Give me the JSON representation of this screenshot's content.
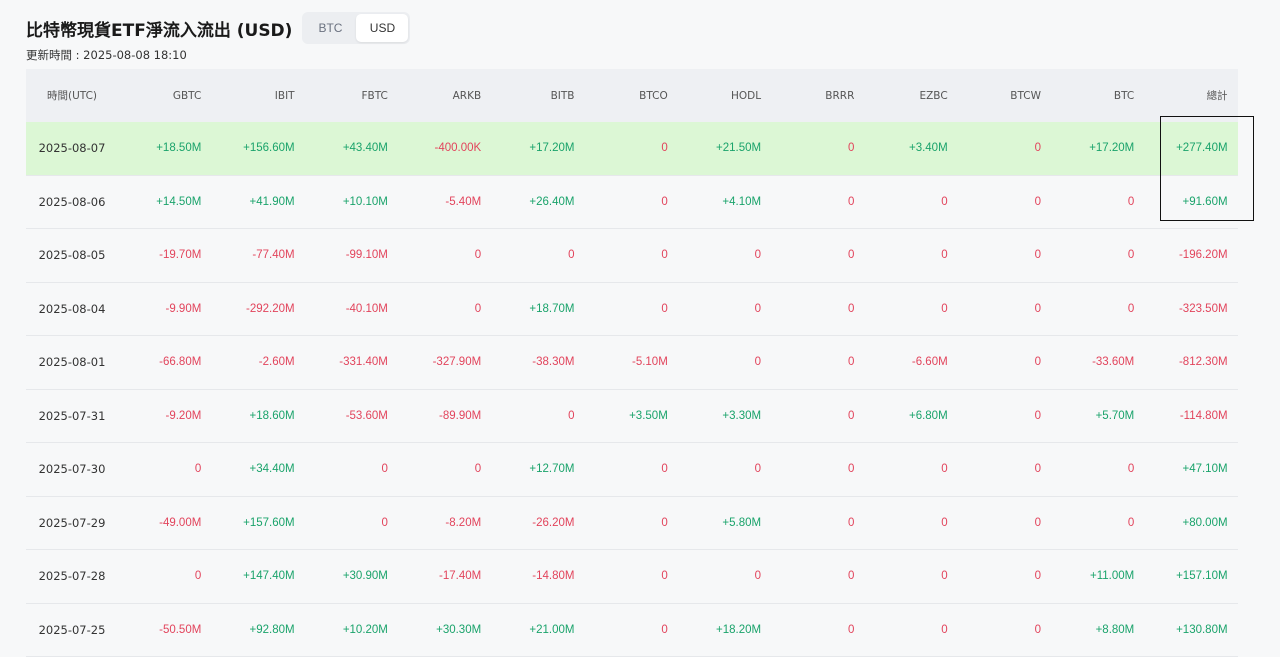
{
  "header": {
    "title": "比特幣現貨ETF淨流入流出 (USD)",
    "toggle": [
      {
        "label": "BTC",
        "active": false
      },
      {
        "label": "USD",
        "active": true
      }
    ]
  },
  "updated": "更新時間 : 2025-08-08 18:10",
  "colors": {
    "positive": "#1aa36b",
    "negative": "#e2445c",
    "highlight_row": "#dcf7d5"
  },
  "table": {
    "columns": [
      "時間(UTC)",
      "GBTC",
      "IBIT",
      "FBTC",
      "ARKB",
      "BITB",
      "BTCO",
      "HODL",
      "BRRR",
      "EZBC",
      "BTCW",
      "BTC",
      "總計"
    ],
    "rows": [
      [
        "2025-08-07",
        "+18.50M",
        "+156.60M",
        "+43.40M",
        "-400.00K",
        "+17.20M",
        "0",
        "+21.50M",
        "0",
        "+3.40M",
        "0",
        "+17.20M",
        "+277.40M"
      ],
      [
        "2025-08-06",
        "+14.50M",
        "+41.90M",
        "+10.10M",
        "-5.40M",
        "+26.40M",
        "0",
        "+4.10M",
        "0",
        "0",
        "0",
        "0",
        "+91.60M"
      ],
      [
        "2025-08-05",
        "-19.70M",
        "-77.40M",
        "-99.10M",
        "0",
        "0",
        "0",
        "0",
        "0",
        "0",
        "0",
        "0",
        "-196.20M"
      ],
      [
        "2025-08-04",
        "-9.90M",
        "-292.20M",
        "-40.10M",
        "0",
        "+18.70M",
        "0",
        "0",
        "0",
        "0",
        "0",
        "0",
        "-323.50M"
      ],
      [
        "2025-08-01",
        "-66.80M",
        "-2.60M",
        "-331.40M",
        "-327.90M",
        "-38.30M",
        "-5.10M",
        "0",
        "0",
        "-6.60M",
        "0",
        "-33.60M",
        "-812.30M"
      ],
      [
        "2025-07-31",
        "-9.20M",
        "+18.60M",
        "-53.60M",
        "-89.90M",
        "0",
        "+3.50M",
        "+3.30M",
        "0",
        "+6.80M",
        "0",
        "+5.70M",
        "-114.80M"
      ],
      [
        "2025-07-30",
        "0",
        "+34.40M",
        "0",
        "0",
        "+12.70M",
        "0",
        "0",
        "0",
        "0",
        "0",
        "0",
        "+47.10M"
      ],
      [
        "2025-07-29",
        "-49.00M",
        "+157.60M",
        "0",
        "-8.20M",
        "-26.20M",
        "0",
        "+5.80M",
        "0",
        "0",
        "0",
        "0",
        "+80.00M"
      ],
      [
        "2025-07-28",
        "0",
        "+147.40M",
        "+30.90M",
        "-17.40M",
        "-14.80M",
        "0",
        "0",
        "0",
        "0",
        "0",
        "+11.00M",
        "+157.10M"
      ],
      [
        "2025-07-25",
        "-50.50M",
        "+92.80M",
        "+10.20M",
        "+30.30M",
        "+21.00M",
        "0",
        "+18.20M",
        "0",
        "0",
        "0",
        "+8.80M",
        "+130.80M"
      ]
    ]
  }
}
